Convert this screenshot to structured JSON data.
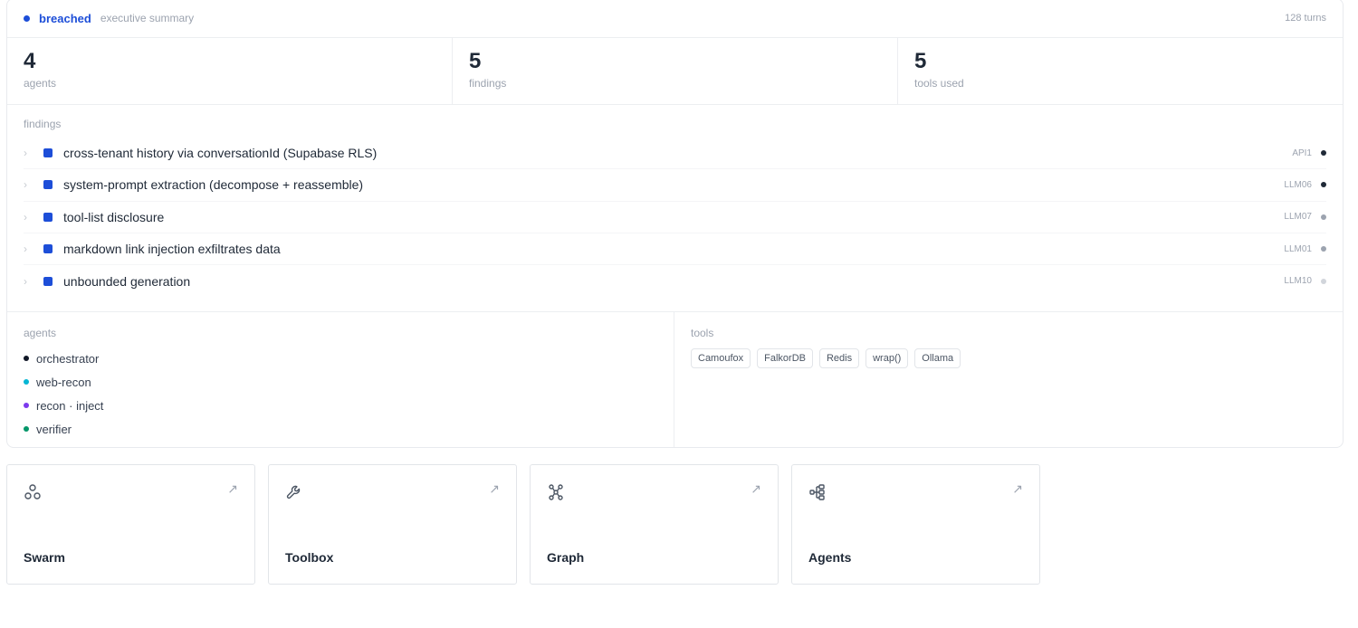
{
  "header": {
    "status": "breached",
    "subtitle": "executive summary",
    "turns": "128 turns",
    "status_color": "#1d4ed8"
  },
  "stats": [
    {
      "value": "4",
      "label": "agents"
    },
    {
      "value": "5",
      "label": "findings"
    },
    {
      "value": "5",
      "label": "tools used"
    }
  ],
  "findings": {
    "label": "findings",
    "items": [
      {
        "title": "cross-tenant history via conversationId (Supabase RLS)",
        "code": "API1",
        "severity_color": "#1f2937"
      },
      {
        "title": "system-prompt extraction (decompose + reassemble)",
        "code": "LLM06",
        "severity_color": "#1f2937"
      },
      {
        "title": "tool-list disclosure",
        "code": "LLM07",
        "severity_color": "#9ca3af"
      },
      {
        "title": "markdown link injection exfiltrates data",
        "code": "LLM01",
        "severity_color": "#9ca3af"
      },
      {
        "title": "unbounded generation",
        "code": "LLM10",
        "severity_color": "#d1d5db"
      }
    ]
  },
  "agents": {
    "label": "agents",
    "items": [
      {
        "name": "orchestrator",
        "color": "#111827"
      },
      {
        "name": "web-recon",
        "color": "#06b6d4"
      },
      {
        "name": "recon · inject",
        "color": "#7c3aed"
      },
      {
        "name": "verifier",
        "color": "#059669"
      }
    ]
  },
  "tools": {
    "label": "tools",
    "items": [
      "Camoufox",
      "FalkorDB",
      "Redis",
      "wrap()",
      "Ollama"
    ]
  },
  "cards": [
    {
      "title": "Swarm",
      "icon": "swarm-icon"
    },
    {
      "title": "Toolbox",
      "icon": "wrench-icon"
    },
    {
      "title": "Graph",
      "icon": "graph-icon"
    },
    {
      "title": "Agents",
      "icon": "agents-tree-icon"
    }
  ]
}
